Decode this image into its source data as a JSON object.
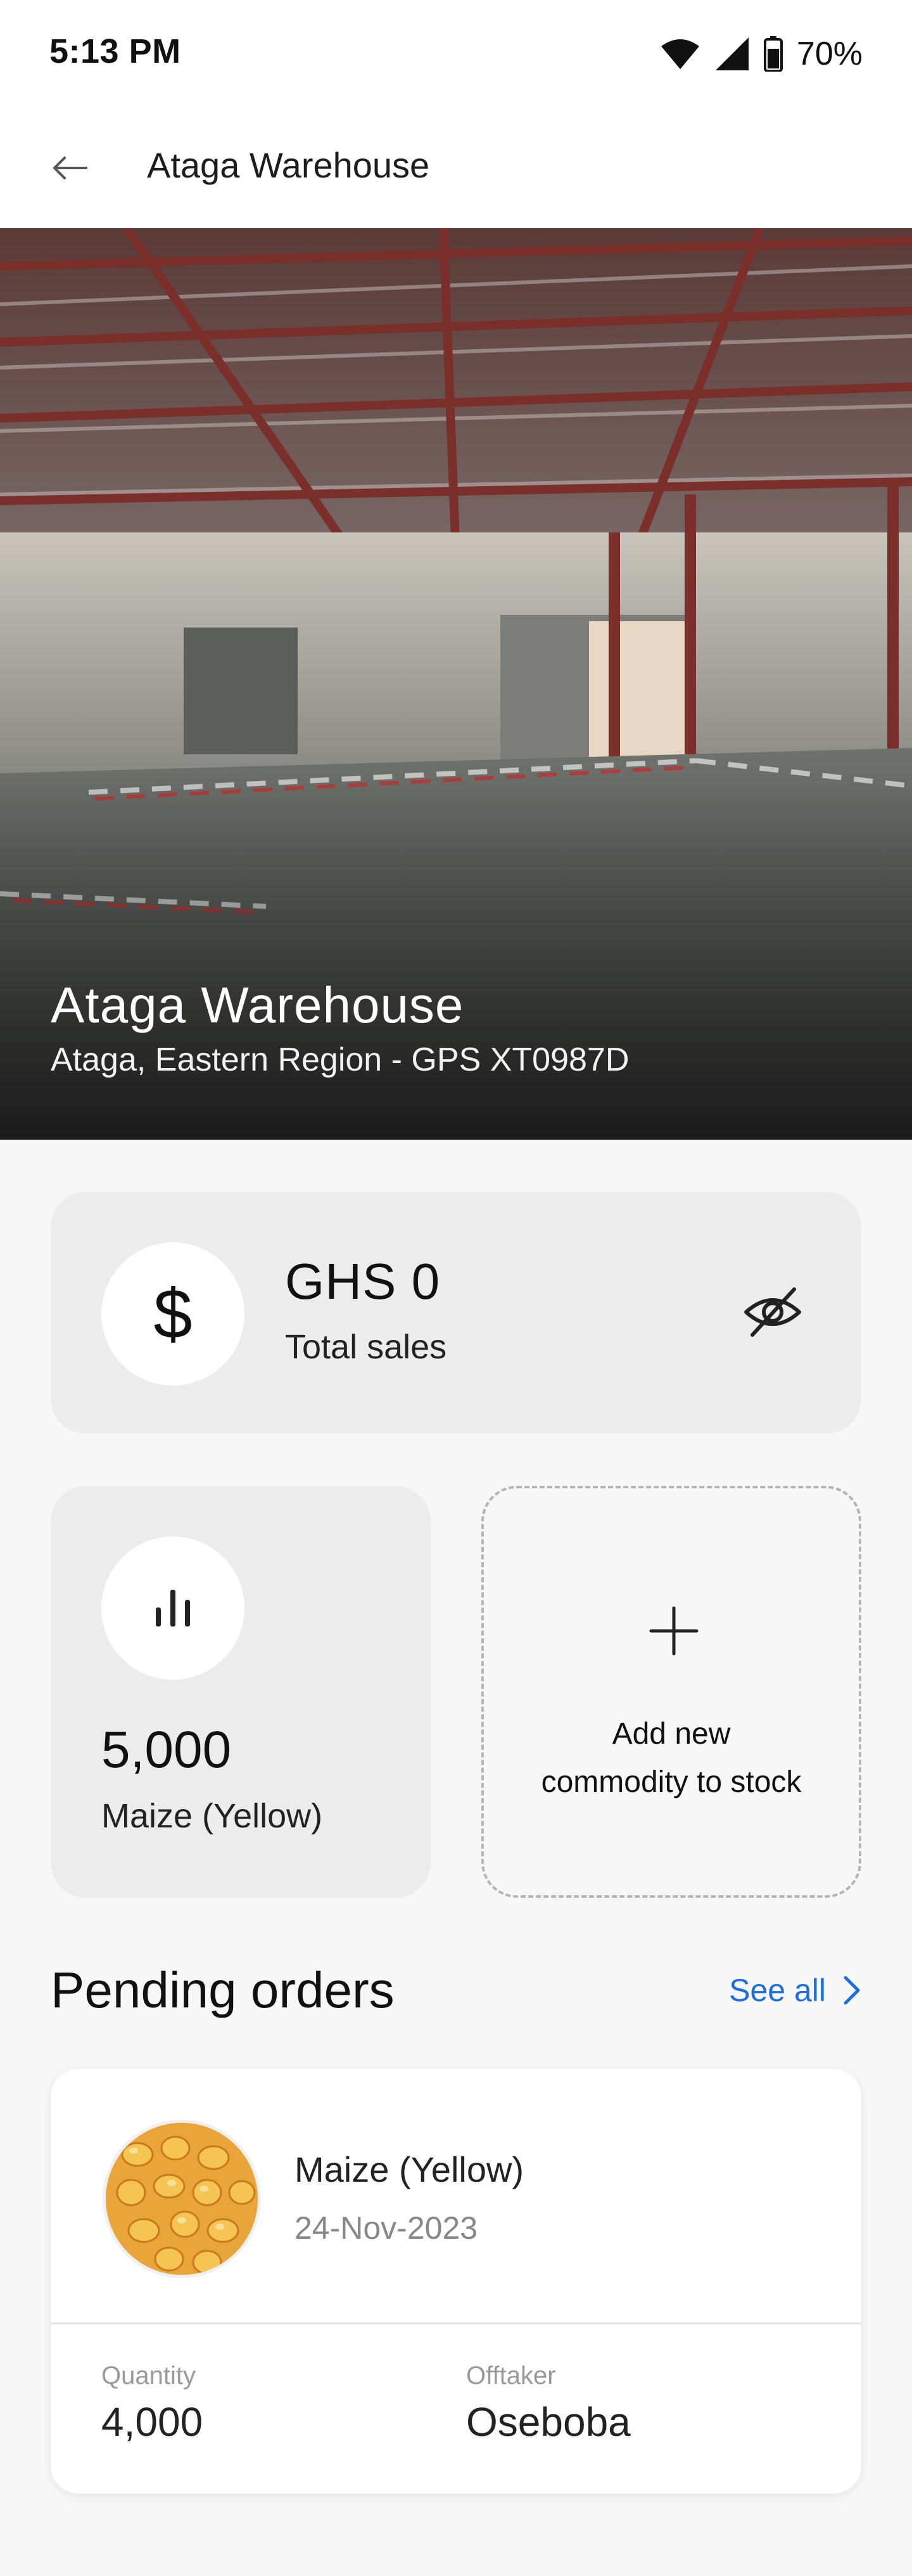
{
  "status_bar": {
    "time": "5:13 PM",
    "battery": "70%"
  },
  "app_bar": {
    "title": "Ataga Warehouse"
  },
  "hero": {
    "title": "Ataga Warehouse",
    "subtitle": "Ataga, Eastern Region - GPS XT0987D"
  },
  "sales": {
    "currency_symbol": "$",
    "amount": "GHS 0",
    "label": "Total sales"
  },
  "stock": {
    "quantity": "5,000",
    "commodity": "Maize (Yellow)"
  },
  "add_commodity": {
    "line1": "Add new",
    "line2": "commodity to stock"
  },
  "pending_orders": {
    "title": "Pending orders",
    "see_all": "See all",
    "orders": [
      {
        "commodity": "Maize (Yellow)",
        "date": "24-Nov-2023",
        "quantity_label": "Quantity",
        "quantity": "4,000",
        "offtaker_label": "Offtaker",
        "offtaker": "Oseboba"
      }
    ]
  },
  "colors": {
    "accent": "#1a6ee0",
    "card_bg": "#ececec",
    "page_bg": "#f7f7f7"
  },
  "icons": {
    "back": "arrow-left-icon",
    "hide": "eye-off-icon",
    "stock": "bar-chart-icon",
    "add": "plus-icon",
    "see_all": "chevron-right-icon"
  }
}
